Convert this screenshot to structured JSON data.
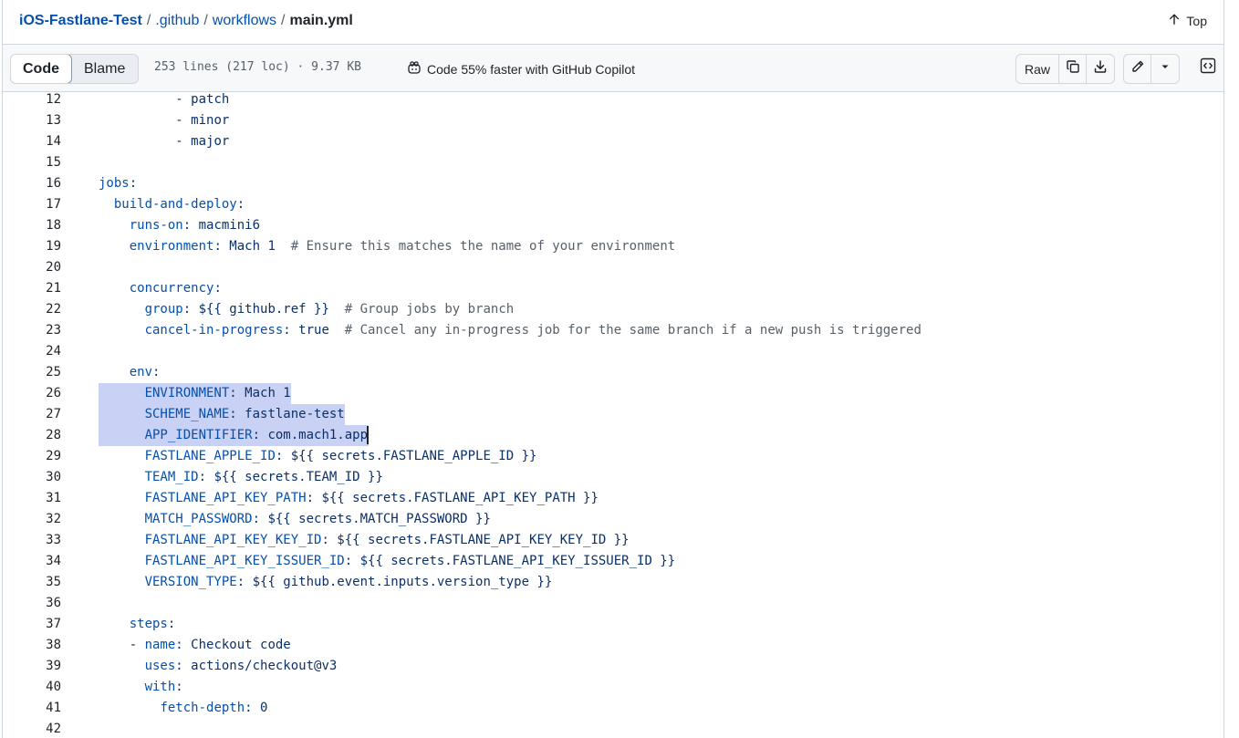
{
  "breadcrumb": {
    "repo": "iOS-Fastlane-Test",
    "dir1": ".github",
    "dir2": "workflows",
    "file": "main.yml",
    "sep": "/",
    "top_label": "Top"
  },
  "toolbar": {
    "code_tab": "Code",
    "blame_tab": "Blame",
    "file_meta": "253 lines (217 loc) · 9.37 KB",
    "copilot_text": "Code 55% faster with GitHub Copilot",
    "raw_label": "Raw"
  },
  "code": {
    "lines": [
      {
        "n": "12",
        "indent": "          ",
        "key": "",
        "rest": "- patch"
      },
      {
        "n": "13",
        "indent": "          ",
        "key": "",
        "rest": "- minor"
      },
      {
        "n": "14",
        "indent": "          ",
        "key": "",
        "rest": "- major"
      },
      {
        "n": "15",
        "indent": "",
        "key": "",
        "rest": ""
      },
      {
        "n": "16",
        "indent": "",
        "key": "jobs",
        "rest": ":"
      },
      {
        "n": "17",
        "indent": "  ",
        "key": "build-and-deploy",
        "rest": ":"
      },
      {
        "n": "18",
        "indent": "    ",
        "key": "runs-on",
        "rest": ": macmini6"
      },
      {
        "n": "19",
        "indent": "    ",
        "key": "environment",
        "rest": ": Mach 1  ",
        "comment": "# Ensure this matches the name of your environment"
      },
      {
        "n": "20",
        "indent": "",
        "key": "",
        "rest": ""
      },
      {
        "n": "21",
        "indent": "    ",
        "key": "concurrency",
        "rest": ":"
      },
      {
        "n": "22",
        "indent": "      ",
        "key": "group",
        "rest": ": ${{ github.ref }}  ",
        "comment": "# Group jobs by branch"
      },
      {
        "n": "23",
        "indent": "      ",
        "key": "cancel-in-progress",
        "rest": ": true  ",
        "comment": "# Cancel any in-progress job for the same branch if a new push is triggered"
      },
      {
        "n": "24",
        "indent": "",
        "key": "",
        "rest": ""
      },
      {
        "n": "25",
        "indent": "    ",
        "key": "env",
        "rest": ":"
      },
      {
        "n": "26",
        "indent": "      ",
        "key": "ENVIRONMENT",
        "rest": ": Mach 1",
        "selected": true
      },
      {
        "n": "27",
        "indent": "      ",
        "key": "SCHEME_NAME",
        "rest": ": fastlane-test",
        "selected": true
      },
      {
        "n": "28",
        "indent": "      ",
        "key": "APP_IDENTIFIER",
        "rest": ": com.mach1.app",
        "selected": true,
        "caret": true
      },
      {
        "n": "29",
        "indent": "      ",
        "key": "FASTLANE_APPLE_ID",
        "rest": ": ${{ secrets.FASTLANE_APPLE_ID }}"
      },
      {
        "n": "30",
        "indent": "      ",
        "key": "TEAM_ID",
        "rest": ": ${{ secrets.TEAM_ID }}"
      },
      {
        "n": "31",
        "indent": "      ",
        "key": "FASTLANE_API_KEY_PATH",
        "rest": ": ${{ secrets.FASTLANE_API_KEY_PATH }}"
      },
      {
        "n": "32",
        "indent": "      ",
        "key": "MATCH_PASSWORD",
        "rest": ": ${{ secrets.MATCH_PASSWORD }}"
      },
      {
        "n": "33",
        "indent": "      ",
        "key": "FASTLANE_API_KEY_KEY_ID",
        "rest": ": ${{ secrets.FASTLANE_API_KEY_KEY_ID }}"
      },
      {
        "n": "34",
        "indent": "      ",
        "key": "FASTLANE_API_KEY_ISSUER_ID",
        "rest": ": ${{ secrets.FASTLANE_API_KEY_ISSUER_ID }}"
      },
      {
        "n": "35",
        "indent": "      ",
        "key": "VERSION_TYPE",
        "rest": ": ${{ github.event.inputs.version_type }}"
      },
      {
        "n": "36",
        "indent": "",
        "key": "",
        "rest": ""
      },
      {
        "n": "37",
        "indent": "    ",
        "key": "steps",
        "rest": ":"
      },
      {
        "n": "38",
        "indent": "    - ",
        "key": "name",
        "rest": ": Checkout code"
      },
      {
        "n": "39",
        "indent": "      ",
        "key": "uses",
        "rest": ": actions/checkout@v3"
      },
      {
        "n": "40",
        "indent": "      ",
        "key": "with",
        "rest": ":"
      },
      {
        "n": "41",
        "indent": "        ",
        "key": "fetch-depth",
        "rest": ": 0"
      },
      {
        "n": "42",
        "indent": "",
        "key": "",
        "rest": ""
      }
    ]
  },
  "colors": {
    "link": "#0550ae",
    "selection": "#c9d1f4",
    "border": "#d0d7de"
  }
}
